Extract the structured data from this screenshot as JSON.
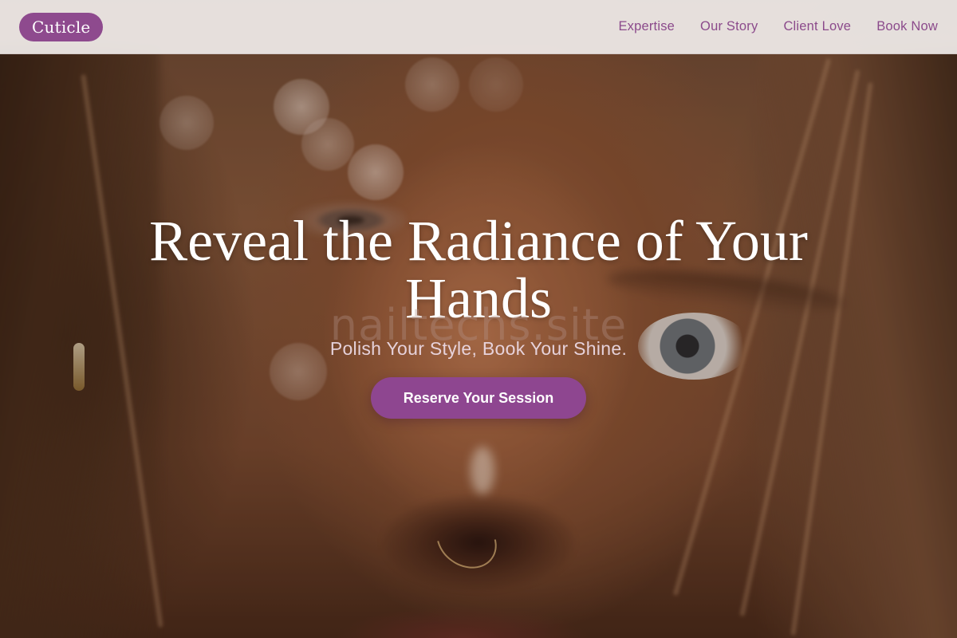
{
  "header": {
    "logo": "Cuticle",
    "nav": [
      "Expertise",
      "Our Story",
      "Client Love",
      "Book Now"
    ]
  },
  "hero": {
    "headline": "Reveal the Radiance of Your Hands",
    "watermark": "nailtechs.site",
    "subtitle": "Polish Your Style, Book Your Shine.",
    "cta_label": "Reserve Your Session"
  },
  "colors": {
    "brand": "#8e4a8e",
    "header_bg": "#f0ecea",
    "headline": "#ffffff"
  }
}
